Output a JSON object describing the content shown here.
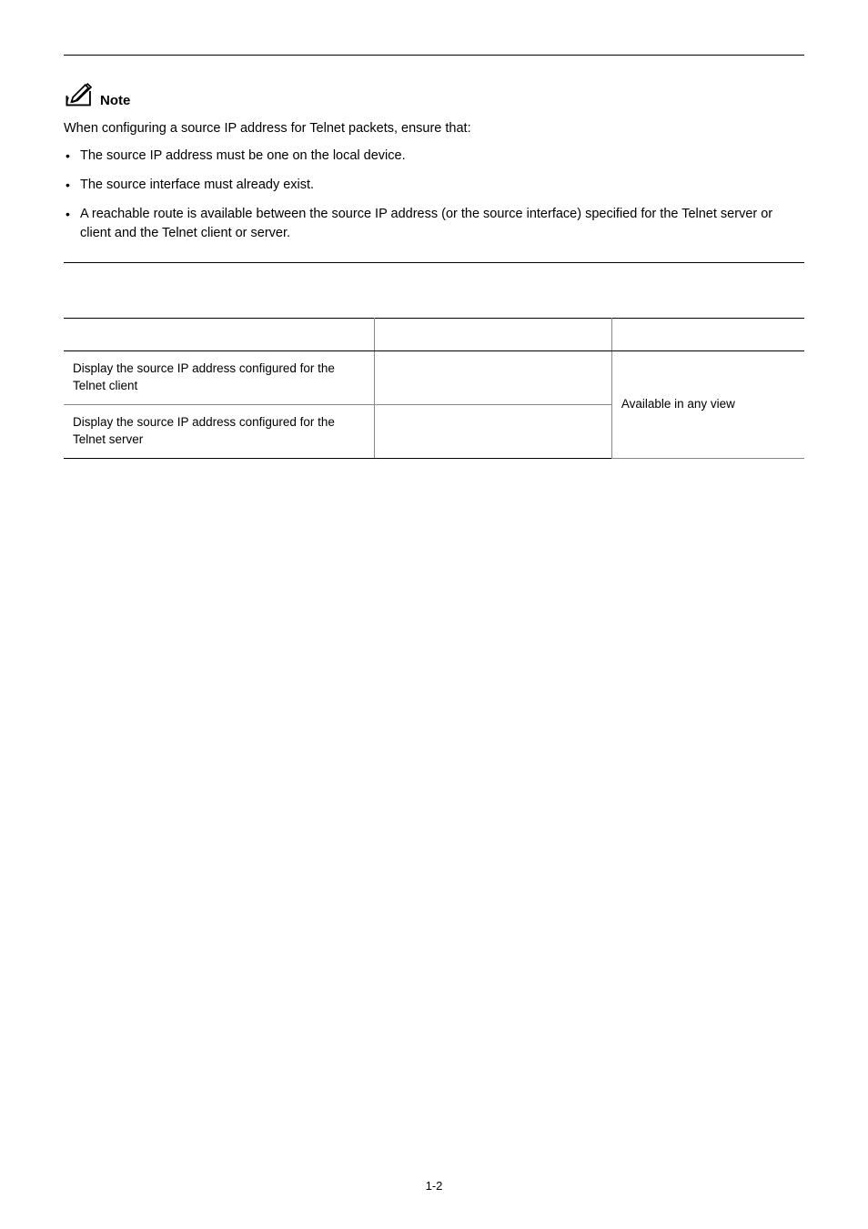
{
  "note": {
    "label": "Note",
    "intro": "When configuring a source IP address for Telnet packets, ensure that:",
    "bullets": [
      "The source IP address must be one on the local device.",
      "The source interface must already exist.",
      "A reachable route is available between the source IP address (or the source interface) specified for the Telnet server or client and the Telnet client or server."
    ]
  },
  "chart_data": {
    "type": "table",
    "headers": [
      "",
      "",
      ""
    ],
    "rows": [
      {
        "operation": "Display the source IP address configured for the Telnet client",
        "command": "",
        "description": "Available in any view"
      },
      {
        "operation": "Display the source IP address configured for the Telnet server",
        "command": "",
        "description": "Available in any view"
      }
    ],
    "description_rowspan": 2
  },
  "page_number": "1-2"
}
